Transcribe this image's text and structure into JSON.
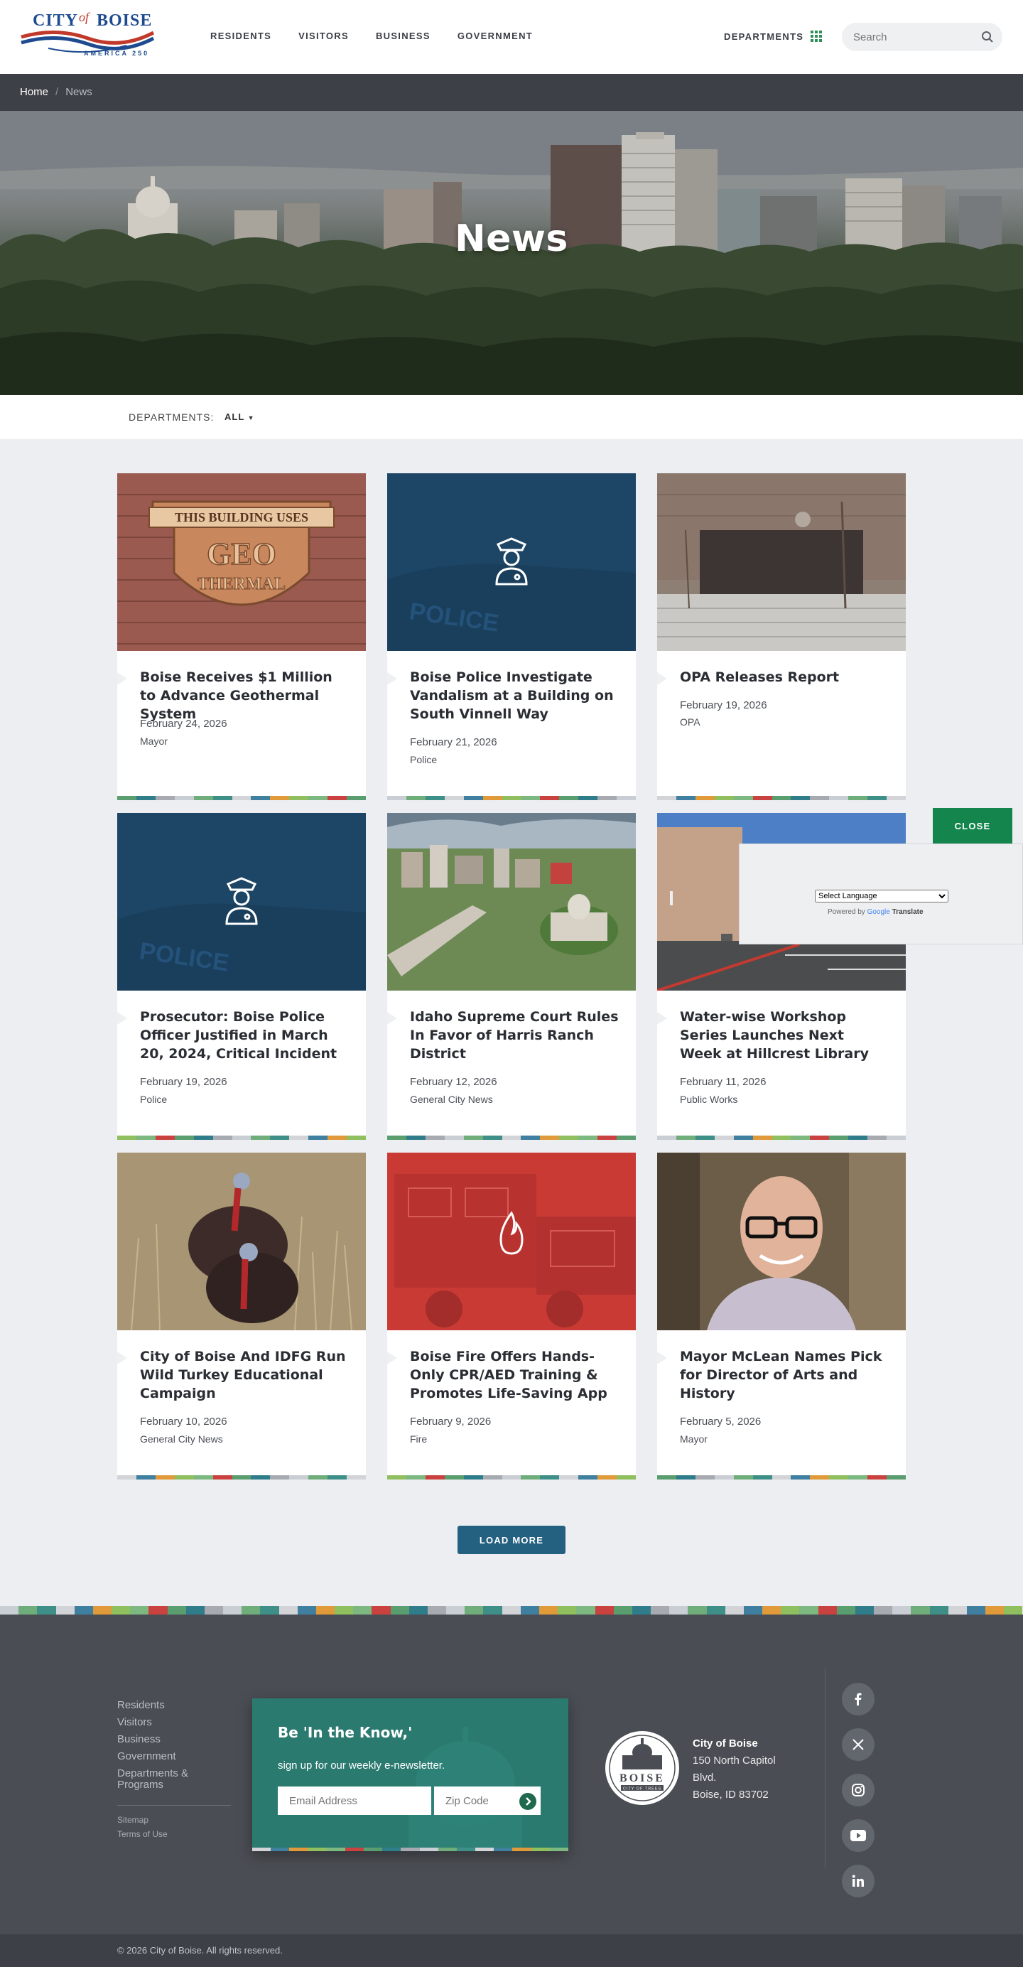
{
  "header": {
    "logo": {
      "city": "CITY",
      "of": "of",
      "boise": "BOISE",
      "america": "AMERICA 250"
    },
    "nav": [
      "RESIDENTS",
      "VISITORS",
      "BUSINESS",
      "GOVERNMENT"
    ],
    "departments_label": "DEPARTMENTS",
    "search_placeholder": "Search"
  },
  "breadcrumb": {
    "home": "Home",
    "separator": "/",
    "current": "News"
  },
  "hero": {
    "title": "News"
  },
  "filter": {
    "label": "DEPARTMENTS:",
    "value": "ALL"
  },
  "cards": [
    {
      "title": "Boise Receives $1 Million to Advance Geothermal System",
      "date": "February 24, 2026",
      "dept": "Mayor",
      "image": "geothermal-plaque"
    },
    {
      "title": "Boise Police Investigate Vandalism at a Building on South Vinnell Way",
      "date": "February 21, 2026",
      "dept": "Police",
      "image": "police-icon"
    },
    {
      "title": "OPA Releases Report",
      "date": "February 19, 2026",
      "dept": "OPA",
      "image": "city-hall"
    },
    {
      "title": "Prosecutor: Boise Police Officer Justified in March 20, 2024, Critical Incident",
      "date": "February 19, 2026",
      "dept": "Police",
      "image": "police-icon"
    },
    {
      "title": "Idaho Supreme Court Rules In Favor of Harris Ranch District",
      "date": "February 12, 2026",
      "dept": "General City News",
      "image": "aerial-downtown"
    },
    {
      "title": "Water-wise Workshop Series Launches Next Week at Hillcrest Library",
      "date": "February 11, 2026",
      "dept": "Public Works",
      "image": "library-building"
    },
    {
      "title": "City of Boise And IDFG Run Wild Turkey Educational Campaign",
      "date": "February 10, 2026",
      "dept": "General City News",
      "image": "wild-turkeys"
    },
    {
      "title": "Boise Fire Offers Hands-Only CPR/AED Training & Promotes Life-Saving App",
      "date": "February 9, 2026",
      "dept": "Fire",
      "image": "fire-icon"
    },
    {
      "title": "Mayor McLean Names Pick for Director of Arts and History",
      "date": "February 5, 2026",
      "dept": "Mayor",
      "image": "portrait"
    }
  ],
  "load_more": "LOAD MORE",
  "translate": {
    "close": "CLOSE",
    "select": "Select Language",
    "powered": "Powered by",
    "google": "Google",
    "translate": "Translate"
  },
  "footer": {
    "nav": [
      "Residents",
      "Visitors",
      "Business",
      "Government",
      "Departments & Programs"
    ],
    "small_links": [
      "Sitemap",
      "Terms of Use"
    ],
    "newsletter": {
      "title": "Be 'In the Know,'",
      "subtitle": "sign up for our weekly e-newsletter.",
      "email_placeholder": "Email Address",
      "zip_placeholder": "Zip Code"
    },
    "address": {
      "name": "City of Boise",
      "line1": "150 North Capitol",
      "line2": "Blvd.",
      "line3": "Boise, ID 83702"
    },
    "seal_text": "BOISE",
    "seal_sub": "CITY OF TREES",
    "social": [
      "facebook-icon",
      "x-icon",
      "instagram-icon",
      "youtube-icon",
      "linkedin-icon"
    ],
    "copyright": "© 2026 City of Boise. All rights reserved."
  },
  "colors": {
    "accent_green": "#14864d",
    "nav_dark": "#3d4046",
    "footer_bg": "#4a4d53",
    "newsletter_teal": "#2b7a70",
    "button_blue": "#24607f"
  }
}
